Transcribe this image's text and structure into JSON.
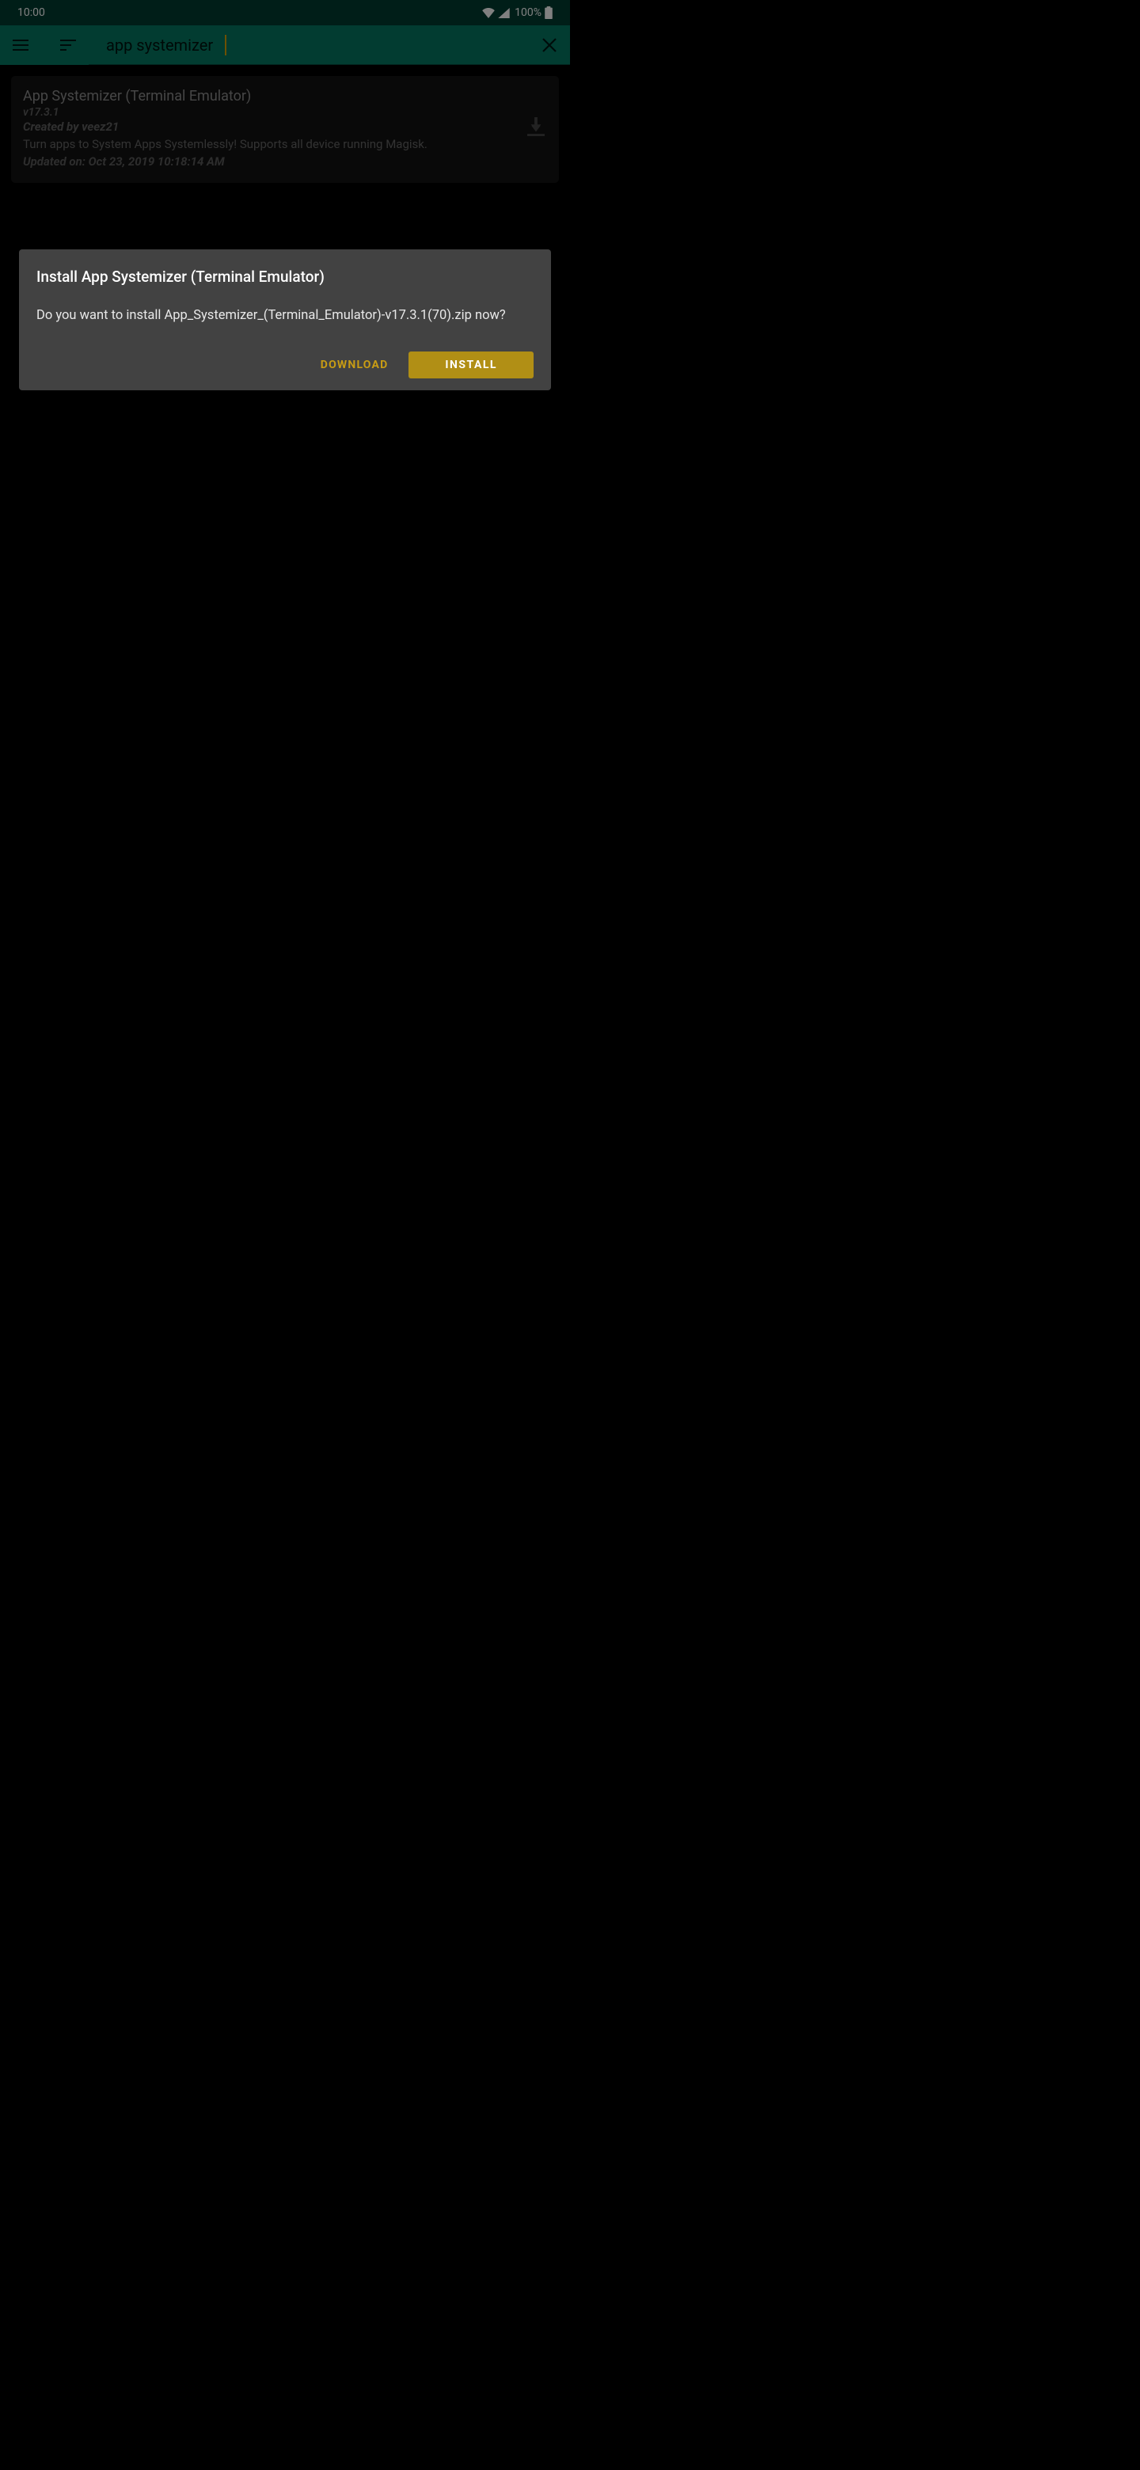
{
  "statusbar": {
    "time": "10:00",
    "battery_pct": "100%"
  },
  "appbar": {
    "search_value": "app systemizer"
  },
  "module": {
    "title": "App Systemizer (Terminal Emulator)",
    "version": "v17.3.1",
    "author": "Created by veez21",
    "description": "Turn apps to System Apps Systemlessly! Supports all device running Magisk.",
    "updated": "Updated on: Oct 23, 2019 10:18:14 AM"
  },
  "dialog": {
    "title": "Install App Systemizer (Terminal Emulator)",
    "body": "Do you want to install App_Systemizer_(Terminal_Emulator)-v17.3.1(70).zip now?",
    "download_label": "DOWNLOAD",
    "install_label": "INSTALL"
  }
}
